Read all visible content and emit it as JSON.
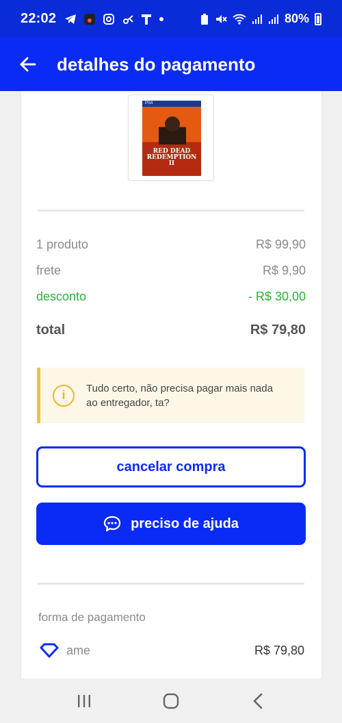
{
  "status_bar": {
    "time": "22:02",
    "battery": "80%"
  },
  "header": {
    "title": "detalhes do pagamento",
    "back_icon": "arrow-left-icon"
  },
  "product": {
    "platform": "PS4",
    "cover_title": "RED DEAD REDEMPTION II"
  },
  "summary": {
    "rows": [
      {
        "label": "1 produto",
        "value": "R$ 99,90"
      },
      {
        "label": "frete",
        "value": "R$ 9,90"
      },
      {
        "label": "desconto",
        "value": "- R$ 30,00"
      }
    ],
    "total_label": "total",
    "total_value": "R$ 79,80"
  },
  "info": {
    "icon": "info-icon",
    "text": "Tudo certo, não precisa pagar mais nada ao entregador, ta?"
  },
  "buttons": {
    "cancel_label": "cancelar compra",
    "help_label": "preciso de ajuda"
  },
  "payment": {
    "label": "forma de pagamento",
    "method": "ame",
    "value": "R$ 79,80"
  },
  "colors": {
    "brand_blue": "#0a2bf5",
    "discount_green": "#2bb236",
    "warning_yellow": "#f2c23a"
  }
}
